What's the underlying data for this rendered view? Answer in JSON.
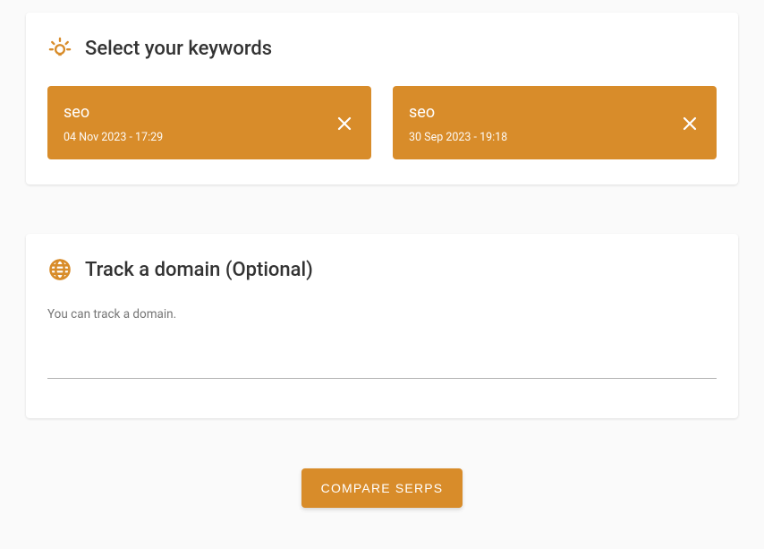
{
  "keywords_section": {
    "title": "Select your keywords",
    "chips": [
      {
        "keyword": "seo",
        "date": "04 Nov 2023 - 17:29"
      },
      {
        "keyword": "seo",
        "date": "30 Sep 2023 - 19:18"
      }
    ]
  },
  "domain_section": {
    "title": "Track a domain (Optional)",
    "description": "You can track a domain.",
    "input_value": ""
  },
  "compare_button_label": "COMPARE SERPS",
  "colors": {
    "accent": "#d88c2a"
  }
}
